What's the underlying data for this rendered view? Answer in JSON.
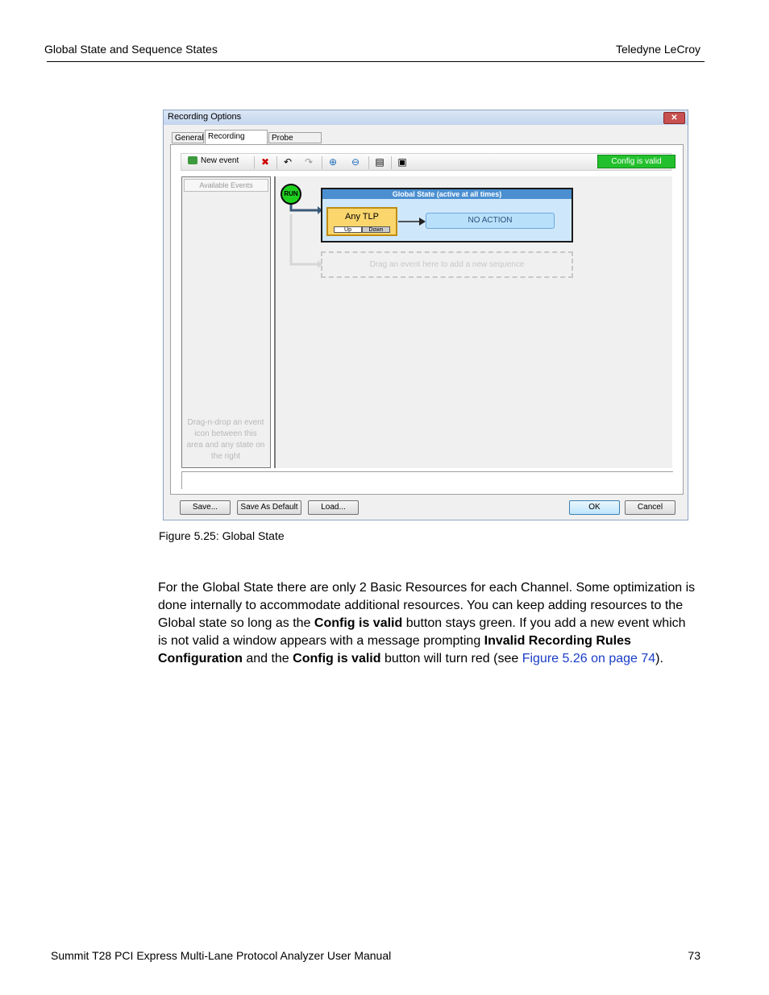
{
  "header": {
    "left": "Global State and Sequence States",
    "right": "Teledyne LeCroy"
  },
  "footer": {
    "left": "Summit T28 PCI Express Multi-Lane Protocol Analyzer User Manual",
    "page": "73"
  },
  "dialog": {
    "title": "Recording Options",
    "close": "✕",
    "tabs": [
      "General",
      "Recording Rules",
      "Probe Settings"
    ],
    "active_tab": "Recording Rules",
    "toolbar": {
      "new_event": "New event",
      "config_status": "Config is valid"
    },
    "available_events": "Available Events",
    "drag_note": "Drag-n-drop an event icon between this area and any state on the right",
    "run_label": "RUN",
    "global_state_title": "Global State (active at all times)",
    "event": {
      "name": "Any TLP",
      "up": "Up",
      "down": "Down"
    },
    "action": "NO ACTION",
    "drop_zone": "Drag an event here to add a new sequence",
    "buttons": {
      "save": "Save...",
      "save_default": "Save As Default",
      "load": "Load...",
      "ok": "OK",
      "cancel": "Cancel"
    },
    "colors": {
      "config_valid": "#22c02c",
      "global_state_header": "#4b8fd0",
      "event_fill": "#fbd66d",
      "run": "#1fd11f"
    }
  },
  "caption": "Figure 5.25:  Global State",
  "paragraph": {
    "p1": "For the Global State there are only 2 Basic Resources for each Channel. Some optimization is done internally to accommodate additional resources. You can keep adding resources to the Global state so long as the ",
    "b1": "Config is valid",
    "p2": " button stays green. If you add a new event which is not valid a window appears with a message prompting ",
    "b2": "Invalid Recording Rules Configuration",
    "p3": " and the ",
    "b3": "Config is valid",
    "p4": " button will turn red (see ",
    "link": "Figure 5.26 on page 74",
    "p5": ")."
  }
}
